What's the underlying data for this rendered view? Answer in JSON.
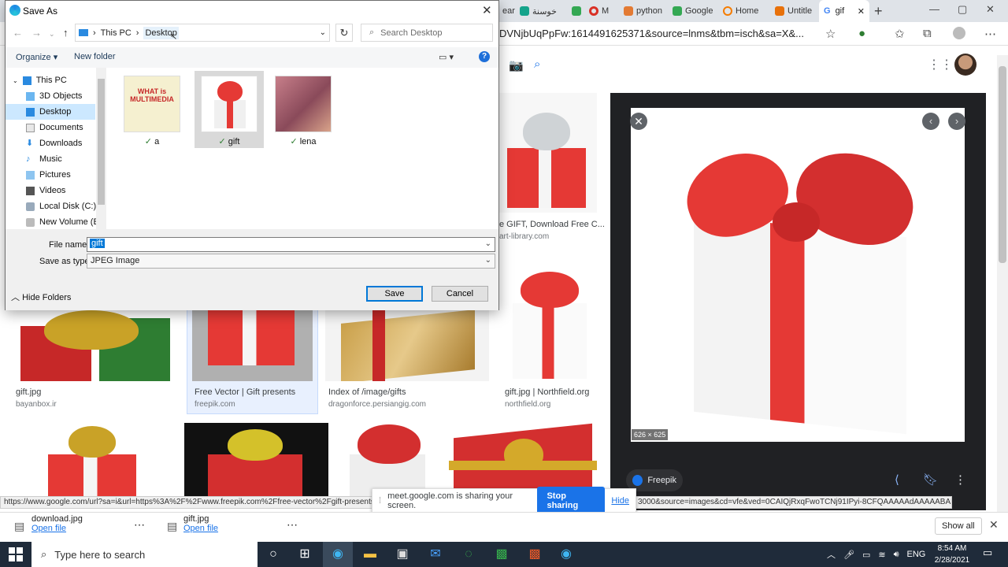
{
  "browser": {
    "tabs": [
      {
        "label": "ear"
      },
      {
        "label": ""
      },
      {
        "label": "خوسنة"
      },
      {
        "label": ""
      },
      {
        "label": "M"
      },
      {
        "label": "python"
      },
      {
        "label": "Google"
      },
      {
        "label": "Home"
      },
      {
        "label": "Untitle"
      }
    ],
    "active_tab": "gif",
    "url": "DVNjbUqPpFw:1614491625371&source=lnms&tbm=isch&sa=X&..."
  },
  "results": [
    {
      "caption": "e GIFT, Download Free C...",
      "source": "art-library.com"
    },
    {
      "caption": "gift.jpg",
      "source": "bayanbox.ir"
    },
    {
      "caption": "Free Vector | Gift presents",
      "source": "freepik.com"
    },
    {
      "caption": "Index of /image/gifts",
      "source": "dragonforce.persiangig.com"
    },
    {
      "caption": "gift.jpg | Northfield.org",
      "source": "northfield.org"
    }
  ],
  "preview": {
    "dimensions": "626 × 625",
    "source": "Freepik"
  },
  "status": {
    "left_url": "https://www.google.com/url?sa=i&url=https%3A%2F%2Fwww.freepik.com%2Ffree-vector%2Fgift-presents",
    "right_url": "3000&source=images&cd=vfe&ved=0CAIQjRxqFwoTCNj91IPyi-8CFQAAAAAdAAAAABAD"
  },
  "sharing": {
    "message": "meet.google.com is sharing your screen.",
    "stop_label": "Stop sharing",
    "hide_label": "Hide"
  },
  "downloads": [
    {
      "name": "download.jpg",
      "action": "Open file"
    },
    {
      "name": "gift.jpg",
      "action": "Open file"
    }
  ],
  "downloads_show_all": "Show all",
  "taskbar": {
    "search_placeholder": "Type here to search",
    "lang": "ENG",
    "time": "8:54 AM",
    "date": "2/28/2021"
  },
  "dialog": {
    "title": "Save As",
    "breadcrumb": [
      "This PC",
      "Desktop"
    ],
    "search_placeholder": "Search Desktop",
    "organize_label": "Organize",
    "new_folder_label": "New folder",
    "nav_items": [
      "This PC",
      "3D Objects",
      "Desktop",
      "Documents",
      "Downloads",
      "Music",
      "Pictures",
      "Videos",
      "Local Disk (C:)",
      "New Volume (E:)"
    ],
    "files": [
      {
        "name": "a",
        "thumb_text": "WHAT is MULTIMEDIA"
      },
      {
        "name": "gift"
      },
      {
        "name": "lena"
      }
    ],
    "file_name_label": "File name:",
    "file_name_value": "gift",
    "save_type_label": "Save as type:",
    "save_type_value": "JPEG Image",
    "hide_folders_label": "Hide Folders",
    "save_label": "Save",
    "cancel_label": "Cancel"
  }
}
